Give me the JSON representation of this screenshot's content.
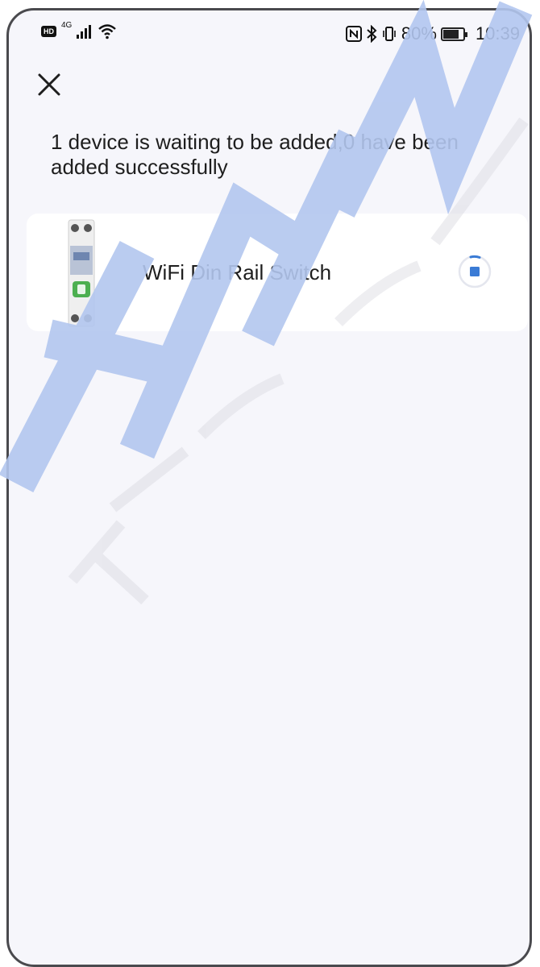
{
  "status_bar": {
    "network_type": "4G",
    "battery_percent": "80%",
    "time": "10:39",
    "icons": [
      "hd-icon",
      "signal-icon",
      "wifi-icon",
      "nfc-icon",
      "bluetooth-icon",
      "vibrate-icon",
      "battery-icon"
    ]
  },
  "header": {
    "close_icon": "close-icon"
  },
  "main": {
    "title": "1 device is waiting to be added,0 have been added successfully",
    "devices": [
      {
        "name": "WiFi Din Rail Switch",
        "status_icon": "stop-spinner-icon"
      }
    ]
  },
  "colors": {
    "background": "#f6f6fb",
    "card": "#ffffff",
    "accent": "#3a7bd5",
    "watermark": "#b3c7ef"
  }
}
